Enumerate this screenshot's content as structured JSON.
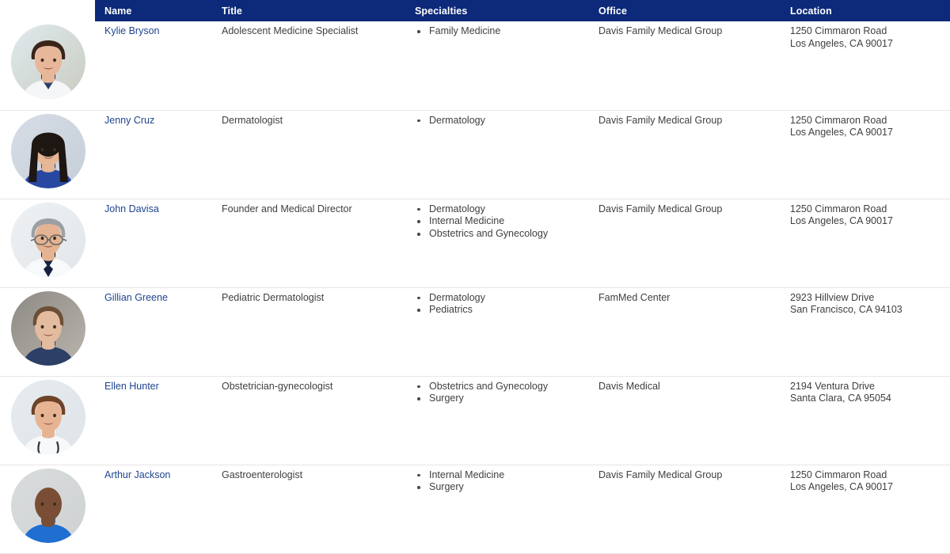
{
  "table": {
    "columns": [
      {
        "key": "avatar",
        "label": ""
      },
      {
        "key": "name",
        "label": "Name"
      },
      {
        "key": "title",
        "label": "Title"
      },
      {
        "key": "specialties",
        "label": "Specialties"
      },
      {
        "key": "office",
        "label": "Office"
      },
      {
        "key": "location",
        "label": "Location"
      }
    ],
    "header_background": "#0d2a7a",
    "header_text_color": "#ffffff",
    "link_color": "#20458f",
    "row_divider_color": "#e6e6e6",
    "rows": [
      {
        "avatar": "photo-portrait-kylie-bryson",
        "name": "Kylie Bryson",
        "title": "Adolescent Medicine Specialist",
        "specialties": [
          "Family Medicine"
        ],
        "office": "Davis Family Medical Group",
        "address_line1": "1250 Cimmaron Road",
        "address_line2": "Los Angeles, CA 90017"
      },
      {
        "avatar": "photo-portrait-jenny-cruz",
        "name": "Jenny Cruz",
        "title": "Dermatologist",
        "specialties": [
          "Dermatology"
        ],
        "office": "Davis Family Medical Group",
        "address_line1": "1250 Cimmaron Road",
        "address_line2": "Los Angeles, CA 90017"
      },
      {
        "avatar": "photo-portrait-john-davisa",
        "name": "John Davisa",
        "title": "Founder and Medical Director",
        "specialties": [
          "Dermatology",
          "Internal Medicine",
          "Obstetrics and Gynecology"
        ],
        "office": "Davis Family Medical Group",
        "address_line1": "1250 Cimmaron Road",
        "address_line2": "Los Angeles, CA 90017"
      },
      {
        "avatar": "photo-portrait-gillian-greene",
        "name": "Gillian Greene",
        "title": "Pediatric Dermatologist",
        "specialties": [
          "Dermatology",
          "Pediatrics"
        ],
        "office": "FamMed Center",
        "address_line1": "2923 Hillview Drive",
        "address_line2": "San Francisco, CA 94103"
      },
      {
        "avatar": "photo-portrait-ellen-hunter",
        "name": "Ellen Hunter",
        "title": "Obstetrician-gynecologist",
        "specialties": [
          "Obstetrics and Gynecology",
          "Surgery"
        ],
        "office": "Davis Medical",
        "address_line1": "2194 Ventura Drive",
        "address_line2": "Santa Clara, CA 95054"
      },
      {
        "avatar": "photo-portrait-arthur-jackson",
        "name": "Arthur Jackson",
        "title": "Gastroenterologist",
        "specialties": [
          "Internal Medicine",
          "Surgery"
        ],
        "office": "Davis Family Medical Group",
        "address_line1": "1250 Cimmaron Road",
        "address_line2": "Los Angeles, CA 90017"
      }
    ]
  }
}
